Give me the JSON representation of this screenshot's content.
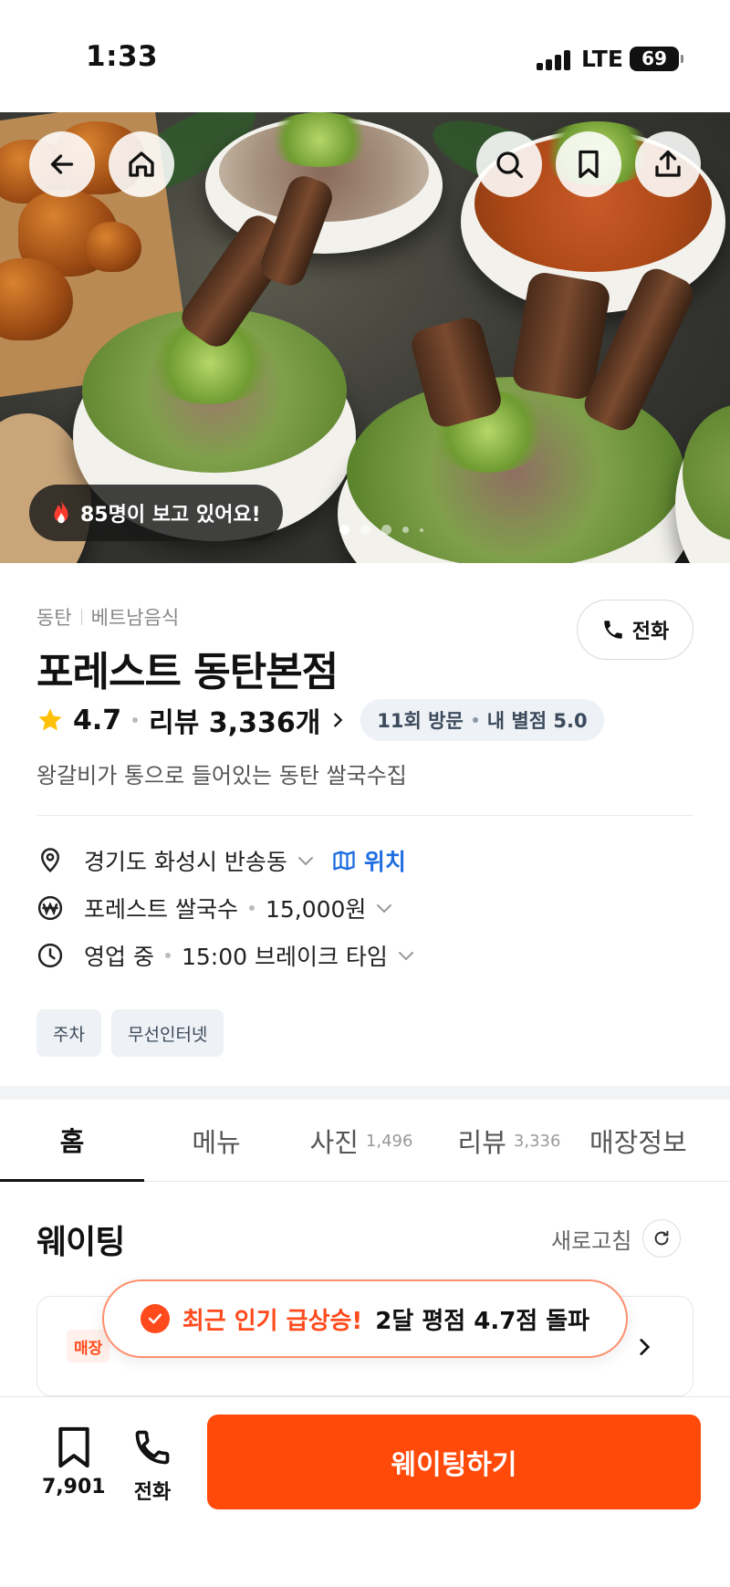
{
  "status_bar": {
    "time": "1:33",
    "network": "LTE",
    "battery": "69"
  },
  "hero": {
    "viewers_text": "85명이 보고 있어요!",
    "icons": [
      "back-icon",
      "home-icon",
      "search-icon",
      "bookmark-icon",
      "share-icon"
    ],
    "carousel_pages": 5,
    "carousel_active": 1
  },
  "store": {
    "region": "동탄",
    "category": "베트남음식",
    "name": "포레스트 동탄본점",
    "rating": "4.7",
    "review_label": "리뷰 3,336개",
    "visit_count": "11회 방문",
    "my_rating": "내 별점 5.0",
    "description": "왕갈비가 통으로 들어있는 동탄 쌀국수집",
    "call_label": "전화"
  },
  "info": {
    "address": "경기도 화성시 반송동",
    "location_label": "위치",
    "menu_name": "포레스트 쌀국수",
    "menu_price": "15,000원",
    "status": "영업 중",
    "break_time": "15:00 브레이크 타임"
  },
  "tags": [
    "주차",
    "무선인터넷"
  ],
  "tabs": [
    {
      "label": "홈",
      "count": ""
    },
    {
      "label": "메뉴",
      "count": ""
    },
    {
      "label": "사진",
      "count": "1,496"
    },
    {
      "label": "리뷰",
      "count": "3,336"
    },
    {
      "label": "매장정보",
      "count": ""
    }
  ],
  "waiting": {
    "title": "웨이팅",
    "refresh_label": "새로고침",
    "store_badge": "매장"
  },
  "toast": {
    "highlight": "최근 인기 급상승!",
    "text": "2달 평점 4.7점 돌파"
  },
  "bottom_bar": {
    "bookmark_count": "7,901",
    "call_label": "전화",
    "cta_label": "웨이팅하기"
  },
  "colors": {
    "accent": "#FF4A0A",
    "link": "#1E6DE0",
    "star": "#FFC107"
  }
}
